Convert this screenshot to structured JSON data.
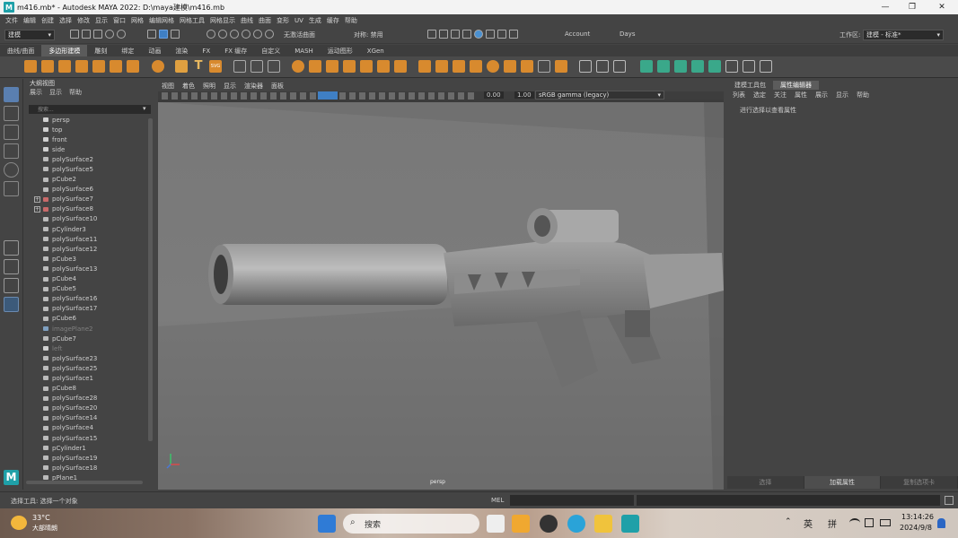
{
  "window": {
    "title": "m416.mb* - Autodesk MAYA 2022: D:\\maya建模\\m416.mb",
    "logo_letter": "M",
    "controls": {
      "minimize": "—",
      "maximize": "❐",
      "close": "✕"
    }
  },
  "menu_bar": [
    "文件",
    "编辑",
    "创建",
    "选择",
    "修改",
    "显示",
    "窗口",
    "网格",
    "编辑网格",
    "网格工具",
    "网格显示",
    "曲线",
    "曲面",
    "变形",
    "UV",
    "生成",
    "缓存",
    "帮助"
  ],
  "status_line": {
    "mode": "建模",
    "no_active_surface": "无激活曲面",
    "symmetry": "对称: 禁用",
    "account": "Account",
    "days": "Days",
    "workspace_label": "工作区:",
    "workspace_value": "建模 - 标准*"
  },
  "shelf_tabs": [
    "曲线/曲面",
    "多边形建模",
    "雕刻",
    "绑定",
    "动画",
    "渲染",
    "FX",
    "FX 缓存",
    "自定义",
    "MASH",
    "运动图形",
    "XGen"
  ],
  "shelf_active_tab": "多边形建模",
  "shelf_text_icons": {
    "text": "T",
    "svg": "SVG"
  },
  "outliner": {
    "title": "大纲视图",
    "menu": [
      "展示",
      "显示",
      "帮助"
    ],
    "search_placeholder": "搜索...",
    "items": [
      {
        "label": "persp",
        "type": "camera",
        "dim": false,
        "expand": false
      },
      {
        "label": "top",
        "type": "camera",
        "dim": false,
        "expand": false
      },
      {
        "label": "front",
        "type": "camera",
        "dim": false,
        "expand": false
      },
      {
        "label": "side",
        "type": "camera",
        "dim": false,
        "expand": false
      },
      {
        "label": "polySurface2",
        "type": "mesh",
        "dim": false,
        "expand": false
      },
      {
        "label": "polySurface5",
        "type": "mesh",
        "dim": false,
        "expand": false
      },
      {
        "label": "pCube2",
        "type": "mesh",
        "dim": false,
        "expand": false
      },
      {
        "label": "polySurface6",
        "type": "mesh",
        "dim": false,
        "expand": false
      },
      {
        "label": "polySurface7",
        "type": "group",
        "dim": false,
        "expand": true
      },
      {
        "label": "polySurface8",
        "type": "group",
        "dim": false,
        "expand": true
      },
      {
        "label": "polySurface10",
        "type": "mesh",
        "dim": false,
        "expand": false
      },
      {
        "label": "pCylinder3",
        "type": "mesh",
        "dim": false,
        "expand": false
      },
      {
        "label": "polySurface11",
        "type": "mesh",
        "dim": false,
        "expand": false
      },
      {
        "label": "polySurface12",
        "type": "mesh",
        "dim": false,
        "expand": false
      },
      {
        "label": "pCube3",
        "type": "mesh",
        "dim": false,
        "expand": false
      },
      {
        "label": "polySurface13",
        "type": "mesh",
        "dim": false,
        "expand": false
      },
      {
        "label": "pCube4",
        "type": "mesh",
        "dim": false,
        "expand": false
      },
      {
        "label": "pCube5",
        "type": "mesh",
        "dim": false,
        "expand": false
      },
      {
        "label": "polySurface16",
        "type": "mesh",
        "dim": false,
        "expand": false
      },
      {
        "label": "polySurface17",
        "type": "mesh",
        "dim": false,
        "expand": false
      },
      {
        "label": "pCube6",
        "type": "mesh",
        "dim": false,
        "expand": false
      },
      {
        "label": "imagePlane2",
        "type": "image",
        "dim": true,
        "expand": false
      },
      {
        "label": "pCube7",
        "type": "mesh",
        "dim": false,
        "expand": false
      },
      {
        "label": "left",
        "type": "camera",
        "dim": true,
        "expand": false
      },
      {
        "label": "polySurface23",
        "type": "mesh",
        "dim": false,
        "expand": false
      },
      {
        "label": "polySurface25",
        "type": "mesh",
        "dim": false,
        "expand": false
      },
      {
        "label": "polySurface1",
        "type": "mesh",
        "dim": false,
        "expand": false
      },
      {
        "label": "pCube8",
        "type": "mesh",
        "dim": false,
        "expand": false
      },
      {
        "label": "polySurface28",
        "type": "mesh",
        "dim": false,
        "expand": false
      },
      {
        "label": "polySurface20",
        "type": "mesh",
        "dim": false,
        "expand": false
      },
      {
        "label": "polySurface14",
        "type": "mesh",
        "dim": false,
        "expand": false
      },
      {
        "label": "polySurface4",
        "type": "mesh",
        "dim": false,
        "expand": false
      },
      {
        "label": "polySurface15",
        "type": "mesh",
        "dim": false,
        "expand": false
      },
      {
        "label": "pCylinder1",
        "type": "mesh",
        "dim": false,
        "expand": false
      },
      {
        "label": "polySurface19",
        "type": "mesh",
        "dim": false,
        "expand": false
      },
      {
        "label": "polySurface18",
        "type": "mesh",
        "dim": false,
        "expand": false
      },
      {
        "label": "pPlane1",
        "type": "mesh",
        "dim": false,
        "expand": false
      }
    ]
  },
  "viewport": {
    "menu": [
      "视图",
      "着色",
      "照明",
      "显示",
      "渲染器",
      "面板"
    ],
    "value_a": "0.00",
    "value_b": "1.00",
    "color_space": "sRGB gamma (legacy)",
    "camera_label": "persp"
  },
  "right_panel": {
    "tabs": [
      "建模工具包",
      "属性编辑器"
    ],
    "active_tab": "属性编辑器",
    "menu": [
      "列表",
      "选定",
      "关注",
      "属性",
      "展示",
      "显示",
      "帮助"
    ],
    "hint": "进行选择以查看属性",
    "bottom_buttons": [
      "选择",
      "加载属性",
      "复制选项卡"
    ]
  },
  "help_line": {
    "text": "选择工具: 选择一个对象",
    "mel_label": "MEL"
  },
  "taskbar": {
    "weather_temp": "33°C",
    "weather_desc": "大部晴朗",
    "search_placeholder": "搜索",
    "lang_1": "英",
    "lang_2": "拼",
    "time": "13:14:26",
    "date": "2024/9/8"
  },
  "colors": {
    "accent_blue": "#3f7fc4",
    "viewport_bg": "#7d7d7d",
    "maya_teal": "#1fa0a8"
  }
}
